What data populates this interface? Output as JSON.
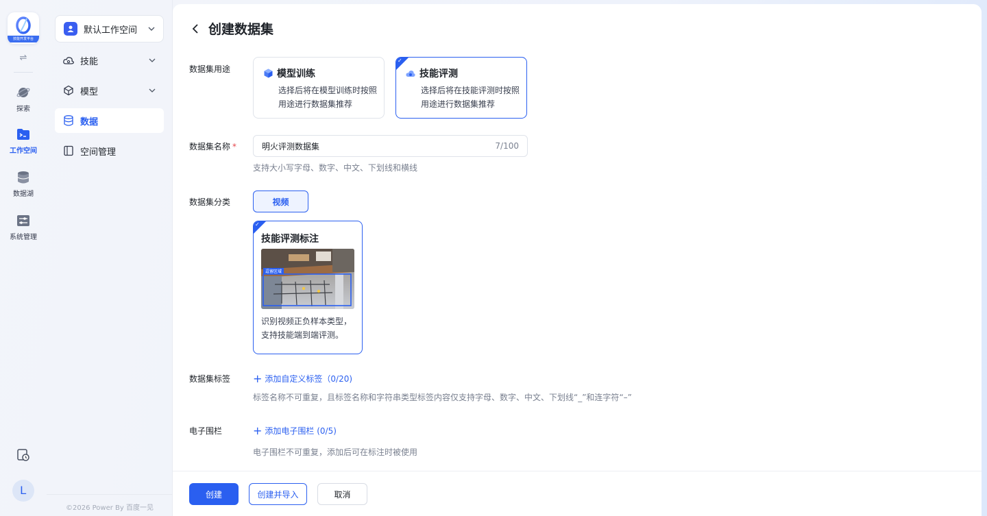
{
  "app": {
    "logo_text": "技能开发平台"
  },
  "rail": {
    "items": [
      {
        "label": "探索",
        "icon": "planet-icon"
      },
      {
        "label": "工作空间",
        "icon": "folder-terminal-icon",
        "active": true
      },
      {
        "label": "数据湖",
        "icon": "database-icon"
      },
      {
        "label": "系统管理",
        "icon": "settings-panel-icon"
      }
    ],
    "avatar_letter": "L"
  },
  "sidebar": {
    "workspace_name": "默认工作空间",
    "nav": [
      {
        "label": "技能",
        "has_chevron": true
      },
      {
        "label": "模型",
        "has_chevron": true
      },
      {
        "label": "数据",
        "active": true
      },
      {
        "label": "空间管理"
      }
    ],
    "footer": "©2026 Power By 百度一见"
  },
  "page": {
    "title": "创建数据集"
  },
  "form": {
    "purpose": {
      "label": "数据集用途",
      "options": [
        {
          "title": "模型训练",
          "desc": "选择后将在模型训练时按照用途进行数据集推荐",
          "selected": false
        },
        {
          "title": "技能评测",
          "desc": "选择后将在技能评测时按照用途进行数据集推荐",
          "selected": true
        }
      ]
    },
    "name": {
      "label": "数据集名称",
      "required_mark": "*",
      "value": "明火评测数据集",
      "count": "7/100",
      "hint": "支持大小写字母、数字、中文、下划线和横线"
    },
    "category": {
      "label": "数据集分类",
      "selected": "视频",
      "type_card": {
        "title": "技能评测标注",
        "image_tag": "逗留区域",
        "desc": "识别视频正负样本类型，支持技能端到端评测。"
      }
    },
    "tags": {
      "label": "数据集标签",
      "add_label": "添加自定义标签（0/20)",
      "hint": "标签名称不可重复，且标签名称和字符串类型标签内容仅支持字母、数字、中文、下划线“_”和连字符“–”"
    },
    "fence": {
      "label": "电子围栏",
      "add_label": "添加电子围栏 (0/5)",
      "hint": "电子围栏不可重复，添加后可在标注时被使用"
    }
  },
  "actions": {
    "create": "创建",
    "create_import": "创建并导入",
    "cancel": "取消"
  },
  "colors": {
    "primary": "#2a5ff0",
    "required": "#e5484d"
  }
}
